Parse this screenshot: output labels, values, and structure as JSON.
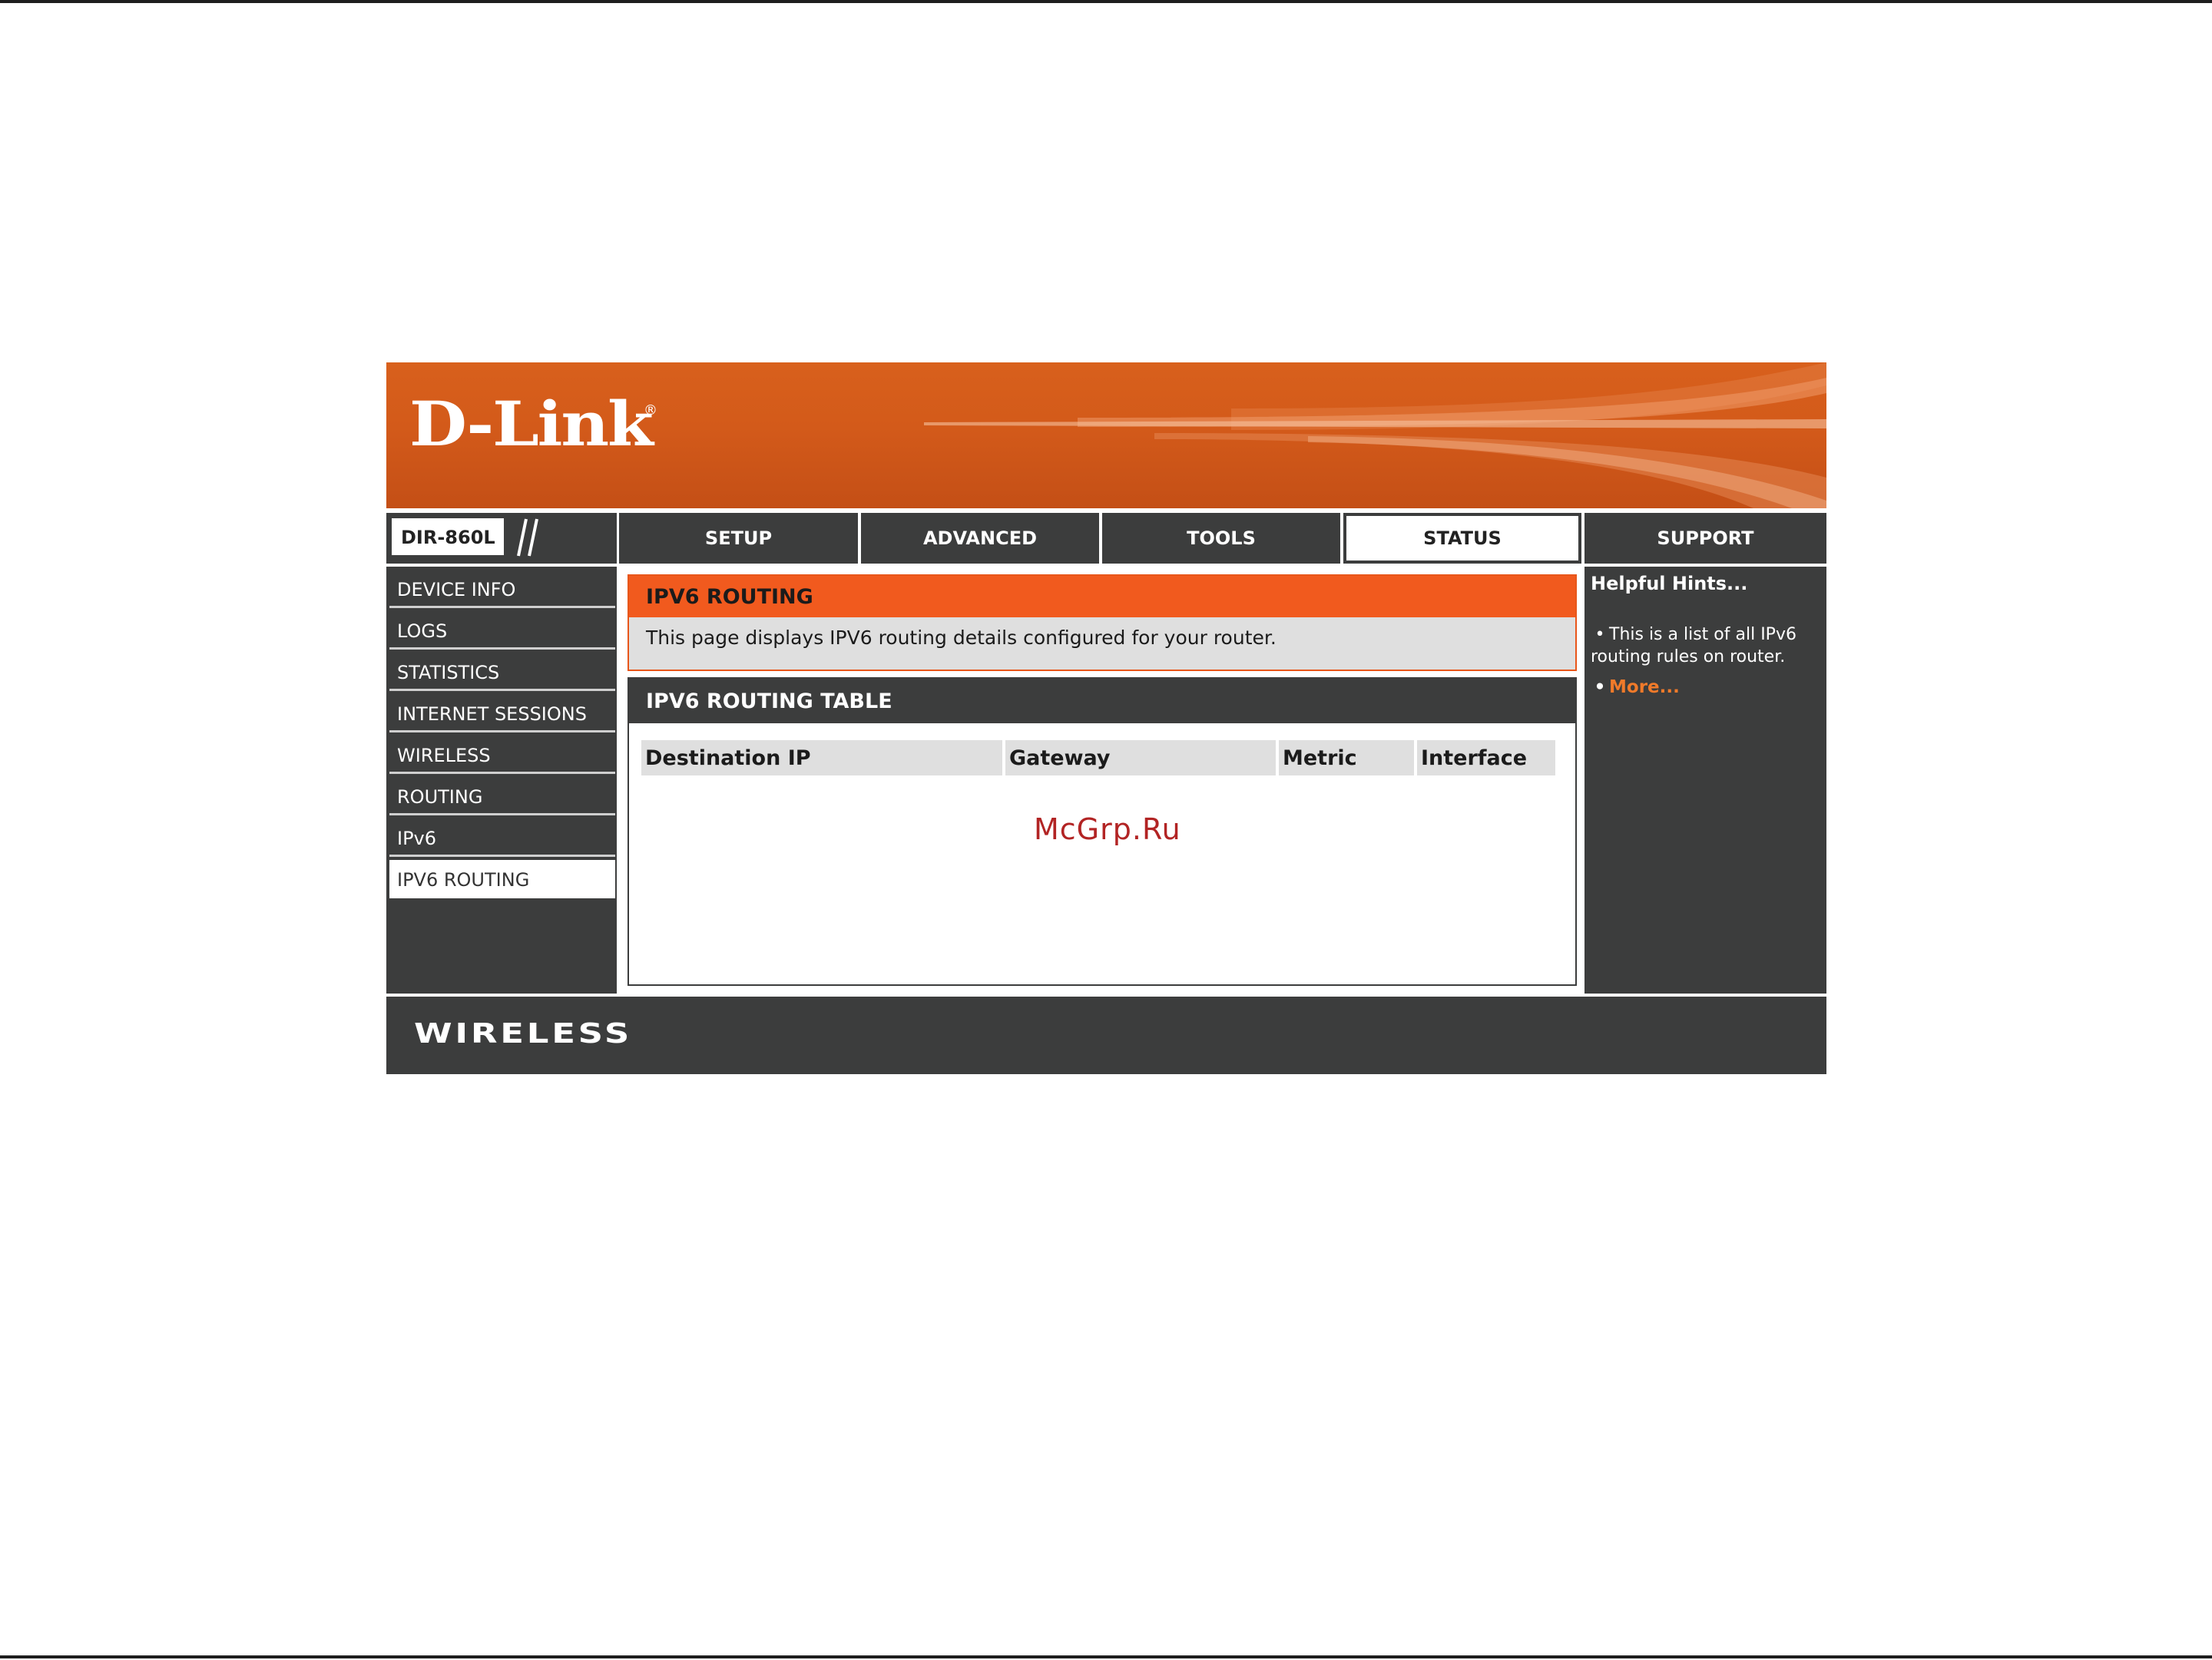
{
  "brand": {
    "logo_text": "D-Link",
    "logo_mark": "®",
    "footer_text": "WIRELESS"
  },
  "model": {
    "label": "DIR-860L"
  },
  "nav": {
    "tabs": [
      {
        "label": "SETUP"
      },
      {
        "label": "ADVANCED"
      },
      {
        "label": "TOOLS"
      },
      {
        "label": "STATUS",
        "active": true
      },
      {
        "label": "SUPPORT"
      }
    ]
  },
  "sidebar": {
    "items": [
      {
        "label": "DEVICE INFO"
      },
      {
        "label": "LOGS"
      },
      {
        "label": "STATISTICS"
      },
      {
        "label": "INTERNET SESSIONS"
      },
      {
        "label": "WIRELESS"
      },
      {
        "label": "ROUTING"
      },
      {
        "label": "IPv6"
      },
      {
        "label": "IPV6 ROUTING",
        "active": true
      }
    ]
  },
  "intro": {
    "title": "IPV6 ROUTING",
    "text": "This page displays IPV6 routing details configured for your router."
  },
  "routing_table": {
    "title": "IPV6 ROUTING TABLE",
    "columns": [
      "Destination IP",
      "Gateway",
      "Metric",
      "Interface"
    ],
    "rows": []
  },
  "hints": {
    "title": "Helpful Hints...",
    "items": [
      "This is a list of all IPv6 routing rules on router."
    ],
    "more_label": "More..."
  },
  "watermark": "McGrp.Ru",
  "colors": {
    "brand_orange": "#d35a1a",
    "header_orange": "#f15a1e",
    "dark_panel": "#3c3d3d",
    "hint_link": "#f07a2a"
  }
}
